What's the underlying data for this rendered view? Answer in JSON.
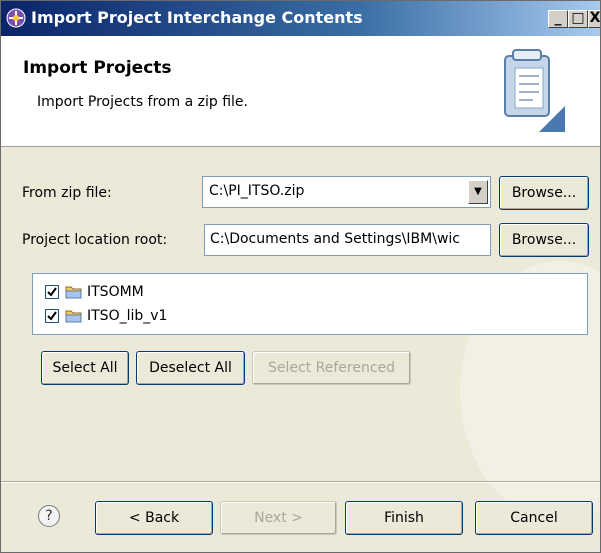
{
  "window": {
    "title": "Import Project Interchange Contents",
    "minimize_glyph": "_",
    "maximize_glyph": "□",
    "close_glyph": "X"
  },
  "header": {
    "title": "Import Projects",
    "description": "Import Projects from a zip file."
  },
  "form": {
    "zip_label": "From zip file:",
    "zip_value": "C:\\PI_ITSO.zip",
    "location_label": "Project location root:",
    "location_value": "C:\\Documents and Settings\\IBM\\wic",
    "browse_label": "Browse..."
  },
  "projects": [
    {
      "name": "ITSOMM",
      "checked": true
    },
    {
      "name": "ITSO_lib_v1",
      "checked": true
    }
  ],
  "selection_buttons": {
    "select_all": "Select All",
    "deselect_all": "Deselect All",
    "select_referenced": "Select Referenced"
  },
  "footer": {
    "help_glyph": "?",
    "back": "< Back",
    "next": "Next >",
    "finish": "Finish",
    "cancel": "Cancel"
  },
  "colors": {
    "title_bar": "#0a246a",
    "dialog_bg": "#ece9d8",
    "disabled_text": "#aca899"
  }
}
